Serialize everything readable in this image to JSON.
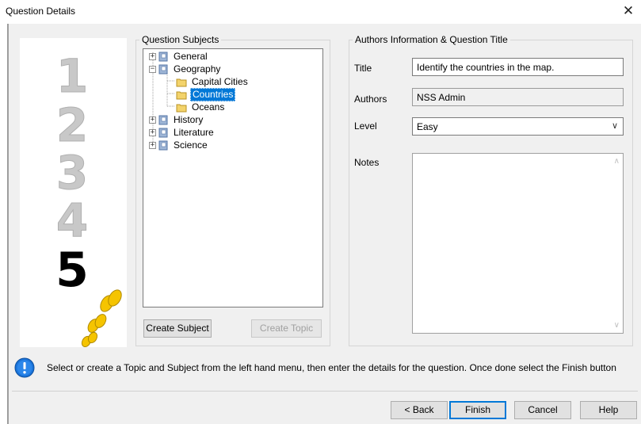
{
  "window": {
    "title": "Question Details",
    "close_glyph": "✕"
  },
  "steps": {
    "labels": [
      "1",
      "2",
      "3",
      "4",
      "5"
    ],
    "current": "5",
    "icon": "footprints-icon"
  },
  "subjects": {
    "legend": "Question Subjects",
    "tree": [
      {
        "label": "General",
        "expander": "+"
      },
      {
        "label": "Geography",
        "expander": "−"
      },
      {
        "label": "Capital Cities"
      },
      {
        "label": "Countries",
        "selected": true
      },
      {
        "label": "Oceans"
      },
      {
        "label": "History",
        "expander": "+"
      },
      {
        "label": "Literature",
        "expander": "+"
      },
      {
        "label": "Science",
        "expander": "+"
      }
    ],
    "create_subject": "Create Subject",
    "create_topic": "Create Topic"
  },
  "details": {
    "legend": "Authors Information & Question Title",
    "title_label": "Title",
    "title_value": "Identify the countries in the map.",
    "authors_label": "Authors",
    "authors_value": "NSS Admin",
    "level_label": "Level",
    "level_value": "Easy",
    "notes_label": "Notes",
    "notes_value": ""
  },
  "info": {
    "icon": "info-icon",
    "message": "Select or create a Topic and Subject from the left hand menu, then enter the details for the question. Once done select the Finish button"
  },
  "buttons": {
    "back": "< Back",
    "finish": "Finish",
    "cancel": "Cancel",
    "help": "Help"
  },
  "colors": {
    "accent": "#0078d7",
    "footprints": "#f5c400",
    "step_done": "#c8c8c8",
    "step_current": "#000000"
  }
}
